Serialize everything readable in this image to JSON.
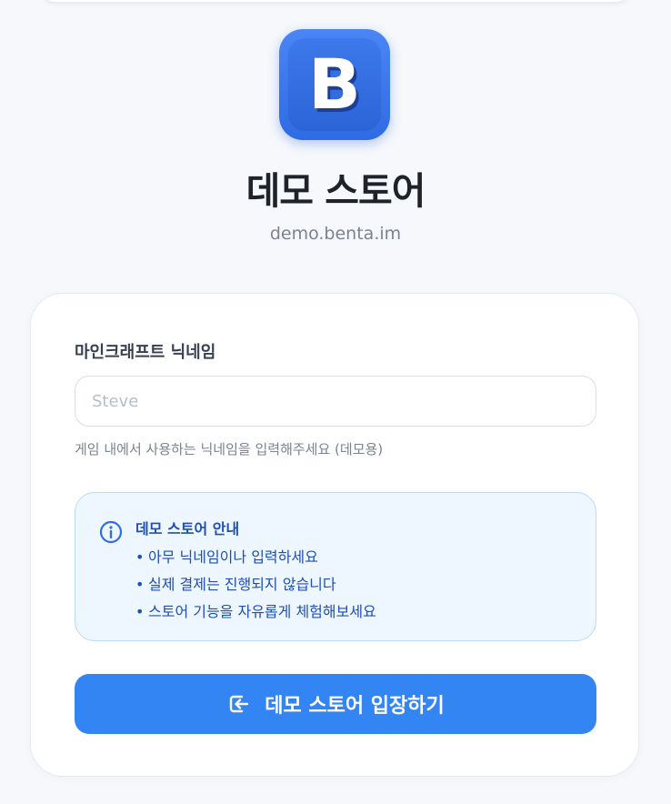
{
  "header": {
    "logo_letter": "B",
    "store_title": "데모 스토어",
    "store_domain": "demo.benta.im"
  },
  "form": {
    "nickname_label": "마인크래프트 닉네임",
    "nickname_placeholder": "Steve",
    "nickname_value": "",
    "nickname_help": "게임 내에서 사용하는 닉네임을 입력해주세요 (데모용)"
  },
  "notice": {
    "icon": "info-icon",
    "title": "데모 스토어 안내",
    "items": [
      "아무 닉네임이나 입력하세요",
      "실제 결제는 진행되지 않습니다",
      "스토어 기능을 자유롭게 체험해보세요"
    ]
  },
  "actions": {
    "enter_icon": "login-icon",
    "enter_label": "데모 스토어 입장하기"
  },
  "colors": {
    "accent": "#3385f3",
    "notice_bg": "#eef6ff",
    "notice_text": "#1e4fb5",
    "background": "#f6f8fb"
  }
}
